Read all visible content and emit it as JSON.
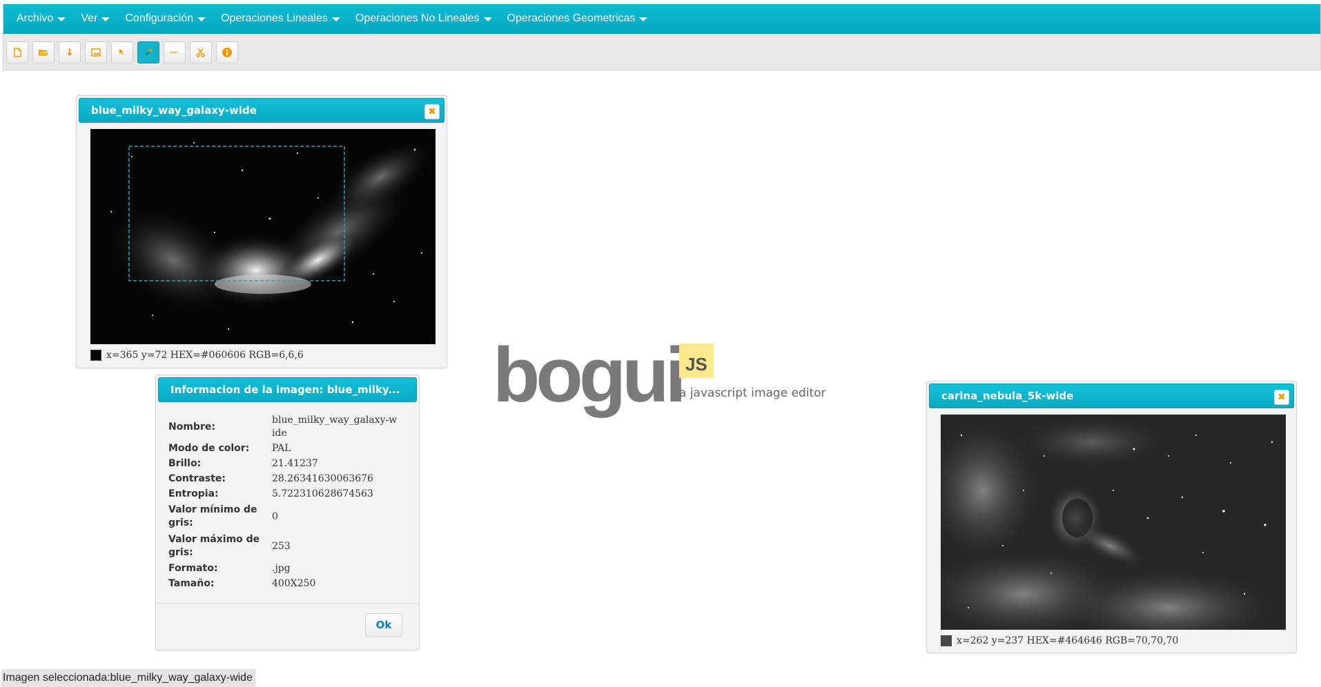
{
  "menu": {
    "items": [
      {
        "label": "Archivo"
      },
      {
        "label": "Ver"
      },
      {
        "label": "Configuración"
      },
      {
        "label": "Operaciones Lineales"
      },
      {
        "label": "Operaciones No Lineales"
      },
      {
        "label": "Operaciones Geometricas"
      }
    ]
  },
  "toolbar": {
    "tools": [
      {
        "icon": "new-file-icon"
      },
      {
        "icon": "open-folder-icon"
      },
      {
        "icon": "download-icon"
      },
      {
        "icon": "image-icon"
      },
      {
        "icon": "cursor-arrow-icon"
      },
      {
        "icon": "region-select-icon",
        "active": true
      },
      {
        "icon": "line-profile-icon"
      },
      {
        "icon": "scissors-icon"
      },
      {
        "icon": "info-icon"
      }
    ]
  },
  "windows": {
    "galaxy": {
      "title": "blue_milky_way_galaxy-wide",
      "close_glyph": "✖",
      "pixel_info": "x=365 y=72 HEX=#060606 RGB=6,6,6",
      "swatch_color": "#060606"
    },
    "info": {
      "title": "Informacion de la imagen: blue_milky...",
      "rows": [
        {
          "label": "Nombre:",
          "value": "blue_milky_way_galaxy-wide"
        },
        {
          "label": "Modo de color:",
          "value": "PAL"
        },
        {
          "label": "Brillo:",
          "value": "21.41237"
        },
        {
          "label": "Contraste:",
          "value": "28.26341630063676"
        },
        {
          "label": "Entropia:",
          "value": "5.722310628674563"
        },
        {
          "label": "Valor mínimo de gris:",
          "value": "0"
        },
        {
          "label": "Valor máximo de gris:",
          "value": "253"
        },
        {
          "label": "Formato:",
          "value": ".jpg"
        },
        {
          "label": "Tamaño:",
          "value": "400X250"
        }
      ],
      "ok_label": "Ok"
    },
    "nebula": {
      "title": "carina_nebula_5k-wide",
      "close_glyph": "✖",
      "pixel_info": "x=262 y=237 HEX=#464646 RGB=70,70,70",
      "swatch_color": "#464646"
    }
  },
  "logo": {
    "word": "bogui",
    "badge": "JS",
    "tagline": "a javascript image editor"
  },
  "status": {
    "text": "Imagen seleccionada:blue_milky_way_galaxy-wide"
  },
  "colors": {
    "accent": "#08aac2",
    "tool_icon": "#f29a00"
  }
}
